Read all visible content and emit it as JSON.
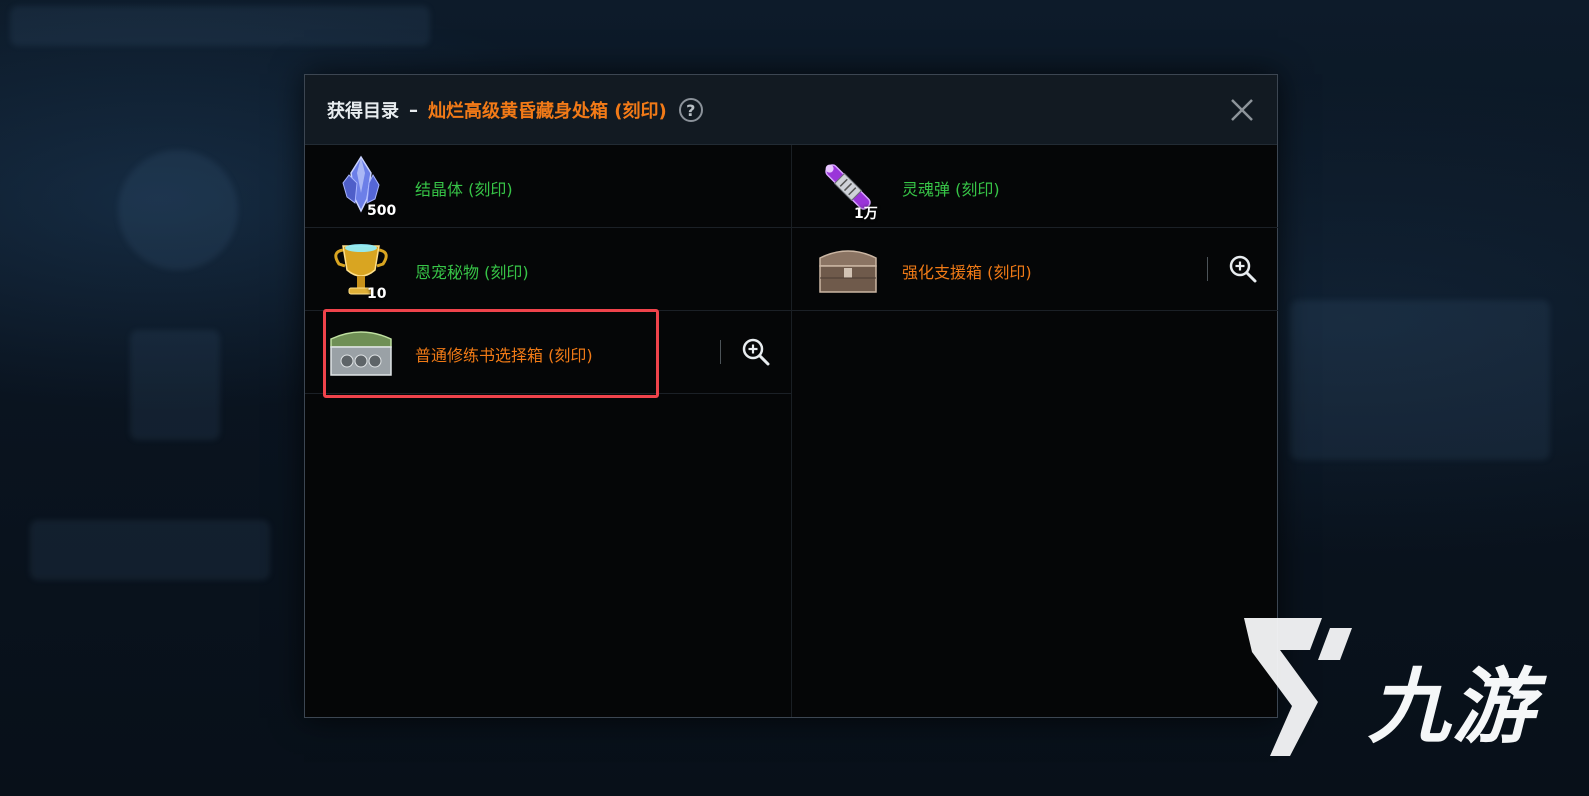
{
  "dialog": {
    "title": "获得目录",
    "separator": "–",
    "item_name": "灿烂高级黄昏藏身处箱 (刻印)",
    "help_icon_text": "?",
    "close_icon": "close-icon"
  },
  "items": [
    {
      "name": "结晶体 (刻印)",
      "quantity": "500",
      "color": "#37c447",
      "icon": "crystal-icon",
      "zoomable": false
    },
    {
      "name": "灵魂弹 (刻印)",
      "quantity": "1万",
      "color": "#37c447",
      "icon": "soul-bullet-icon",
      "zoomable": false
    },
    {
      "name": "恩宠秘物 (刻印)",
      "quantity": "10",
      "color": "#37c447",
      "icon": "trophy-icon",
      "zoomable": false
    },
    {
      "name": "强化支援箱 (刻印)",
      "quantity": "",
      "color": "#f07a16",
      "icon": "chest-icon",
      "zoomable": true
    },
    {
      "name": "普通修练书选择箱 (刻印)",
      "quantity": "",
      "color": "#f07a16",
      "icon": "book-chest-icon",
      "zoomable": true
    }
  ],
  "watermark": {
    "text": "九游"
  },
  "colors": {
    "accent_orange": "#f07a16",
    "green": "#37c447",
    "highlight_red": "#f0434b"
  }
}
